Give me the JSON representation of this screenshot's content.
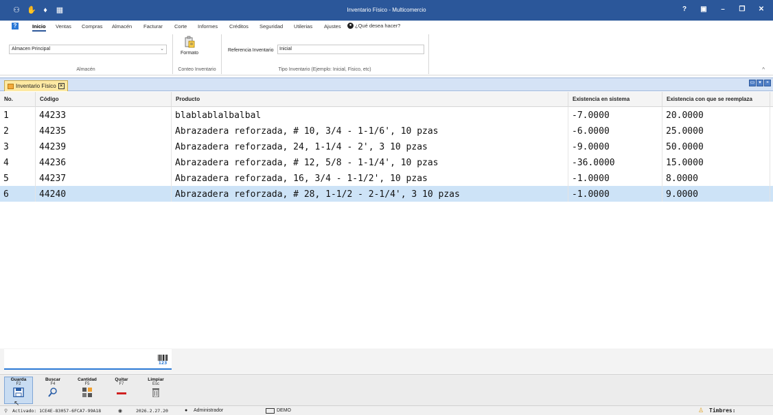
{
  "window": {
    "title": "Inventario Físico - Multicomercio",
    "controls": [
      "?",
      "▣",
      "–",
      "❐",
      "✕"
    ]
  },
  "quick_access": [
    "icon-1",
    "icon-2",
    "icon-3",
    "icon-4"
  ],
  "ribbon": {
    "tabs": [
      "Inicio",
      "Ventas",
      "Compras",
      "Almacén",
      "Facturar",
      "Corte",
      "Informes",
      "Créditos",
      "Seguridad",
      "Utilerias",
      "Ajustes"
    ],
    "active_tab": "Inicio",
    "tell_me": "¿Qué desea hacer?",
    "almacen": {
      "selected": "Almacen Principal",
      "group_label": "Almacén"
    },
    "conteo": {
      "button_label": "Formato",
      "group_label": "Conteo Inventario"
    },
    "tipo": {
      "ref_label": "Referencia Inventario",
      "ref_value": "Inicial",
      "group_label": "Tipo Inventario (Ejemplo: Inicial, Fisico, etc)"
    }
  },
  "doc_tab": {
    "label": "Inventario Físico"
  },
  "grid": {
    "columns": [
      "No.",
      "Código",
      "Producto",
      "Existencia en sistema",
      "Existencia con que se reemplaza"
    ],
    "rows": [
      {
        "no": "1",
        "codigo": "44233",
        "producto": "blablablalbalbal",
        "sistema": "-7.0000",
        "reemplaza": "20.0000"
      },
      {
        "no": "2",
        "codigo": "44235",
        "producto": "Abrazadera reforzada, # 10, 3/4 - 1-1/6', 10 pzas",
        "sistema": "-6.0000",
        "reemplaza": "25.0000"
      },
      {
        "no": "3",
        "codigo": "44239",
        "producto": "Abrazadera reforzada, 24, 1-1/4 - 2', 3 10 pzas",
        "sistema": "-9.0000",
        "reemplaza": "50.0000"
      },
      {
        "no": "4",
        "codigo": "44236",
        "producto": "Abrazadera reforzada, # 12, 5/8 - 1-1/4', 10 pzas",
        "sistema": "-36.0000",
        "reemplaza": "15.0000"
      },
      {
        "no": "5",
        "codigo": "44237",
        "producto": "Abrazadera reforzada, 16, 3/4 - 1-1/2', 10 pzas",
        "sistema": "-1.0000",
        "reemplaza": "8.0000"
      },
      {
        "no": "6",
        "codigo": "44240",
        "producto": "Abrazadera reforzada, # 28, 1-1/2 - 2-1/4', 3 10 pzas",
        "sistema": "-1.0000",
        "reemplaza": "9.0000"
      }
    ],
    "selected_row": 6
  },
  "barcode": {
    "value": "",
    "icon_digits": "123"
  },
  "actions": [
    {
      "label": "Guarda",
      "key": "F2",
      "icon": "save-icon"
    },
    {
      "label": "Buscar",
      "key": "F4",
      "icon": "magnifier-icon"
    },
    {
      "label": "Cantidad",
      "key": "F5",
      "icon": "calculator-icon"
    },
    {
      "label": "Quitar",
      "key": "F7",
      "icon": "minus-icon"
    },
    {
      "label": "Limpiar",
      "key": "Esc",
      "icon": "trash-icon"
    }
  ],
  "status": {
    "activation": "Activado: 1CE4E-83057-6FCA7-99A18",
    "version": "2026.2.27.20",
    "user": "Administrador",
    "mode": "DEMO",
    "timbres_label": "Timbres:"
  },
  "colors": {
    "title_bar": "#2b579a",
    "selected_row": "#cde3f7",
    "doc_tab": "#fde9a3",
    "docbar": "#d5e3f6"
  }
}
